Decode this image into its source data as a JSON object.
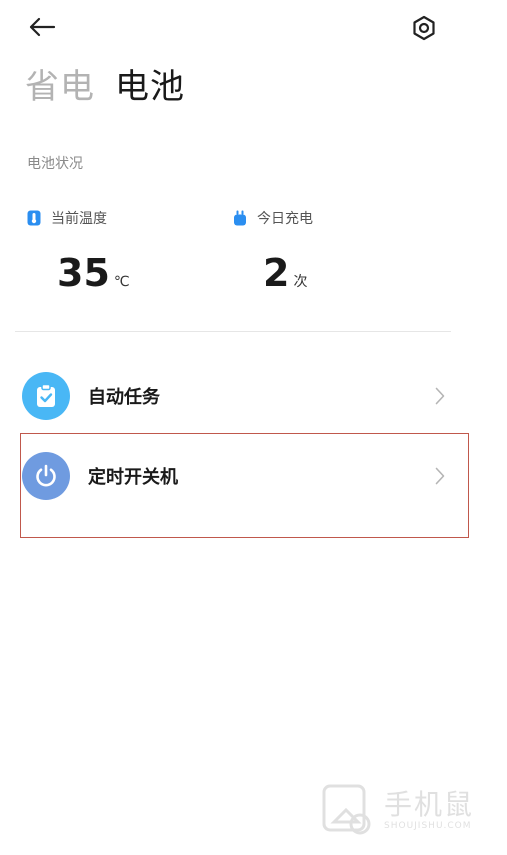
{
  "tabs": [
    {
      "label": "省电",
      "active": false
    },
    {
      "label": "电池",
      "active": true
    }
  ],
  "section_label": "电池状况",
  "stats": [
    {
      "label": "当前温度",
      "value": "35",
      "unit": "℃",
      "icon": "thermometer-icon",
      "color": "#2b8ef0"
    },
    {
      "label": "今日充电",
      "value": "2",
      "unit": "次",
      "icon": "plug-icon",
      "color": "#2b8ef0"
    }
  ],
  "list": [
    {
      "title": "自动任务",
      "icon": "clipboard-check-icon",
      "color": "#49b7f5"
    },
    {
      "title": "定时开关机",
      "icon": "power-icon",
      "color": "#6f9be0"
    }
  ],
  "watermark": {
    "main": "手机鼠",
    "sub": "SHOUJISHU.COM"
  }
}
